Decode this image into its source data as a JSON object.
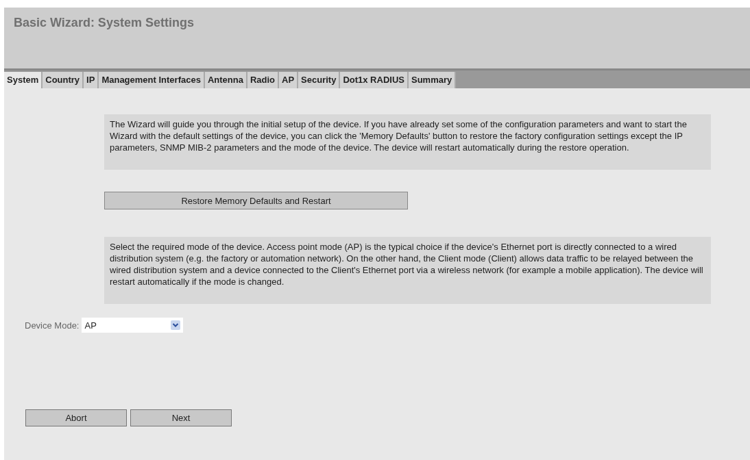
{
  "header": {
    "title": "Basic Wizard: System Settings"
  },
  "tabs": [
    {
      "label": "System",
      "selected": true
    },
    {
      "label": "Country",
      "selected": false
    },
    {
      "label": "IP",
      "selected": false
    },
    {
      "label": "Management Interfaces",
      "selected": false
    },
    {
      "label": "Antenna",
      "selected": false
    },
    {
      "label": "Radio",
      "selected": false
    },
    {
      "label": "AP",
      "selected": false
    },
    {
      "label": "Security",
      "selected": false
    },
    {
      "label": "Dot1x RADIUS",
      "selected": false
    },
    {
      "label": "Summary",
      "selected": false
    }
  ],
  "intro": "The Wizard will guide you through the initial setup of the device. If you have already set some of the configuration parameters and want to start the Wizard with the default settings of the device, you can click the 'Memory Defaults' button to restore the factory configuration settings except the IP parameters, SNMP MIB-2 parameters and the mode of the device. The device will restart automatically during the restore operation.",
  "restore_button": "Restore Memory Defaults and Restart",
  "mode_info": "Select the required mode of the device. Access point mode (AP) is the typical choice if the device's Ethernet port is directly connected to a wired distribution system (e.g. the factory or automation network). On the other hand, the Client mode (Client) allows data traffic to be relayed between the wired distribution system and a device connected to the Client's Ethernet port via a wireless network (for example a mobile application). The device will restart automatically if the mode is changed.",
  "device_mode": {
    "label": "Device Mode:",
    "value": "AP"
  },
  "buttons": [
    "Abort",
    "Next"
  ]
}
